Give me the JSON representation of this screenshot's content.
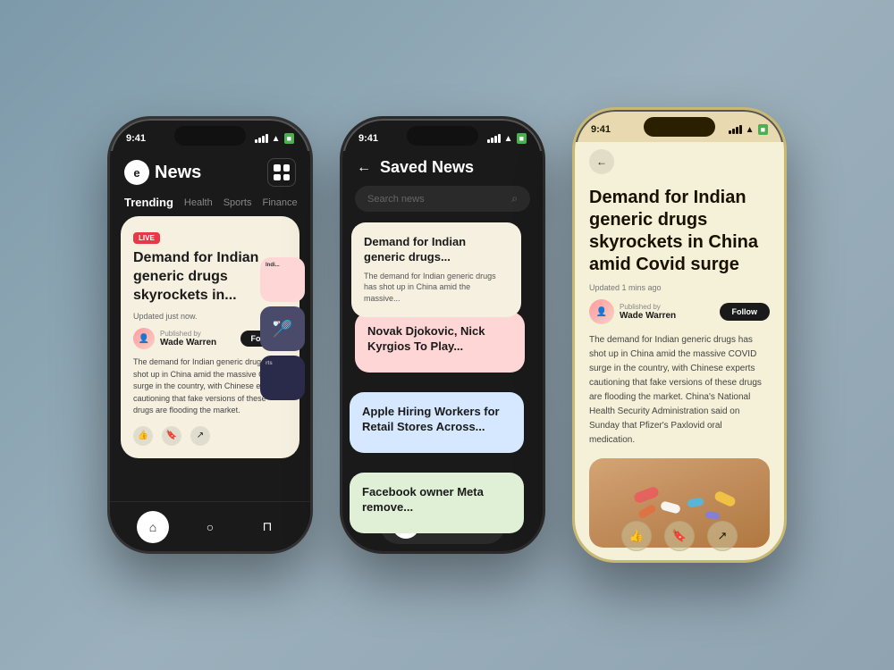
{
  "app": {
    "name": "News",
    "logo_letter": "e",
    "status_time": "9:41"
  },
  "phone1": {
    "header": {
      "logo_text": "News"
    },
    "nav": {
      "tabs": [
        {
          "label": "Trending",
          "active": true
        },
        {
          "label": "Health",
          "active": false
        },
        {
          "label": "Sports",
          "active": false
        },
        {
          "label": "Finance",
          "active": false
        }
      ]
    },
    "main_card": {
      "live_badge": "LIVE",
      "title": "Demand for Indian generic drugs skyrockets in...",
      "updated": "Updated just now.",
      "published_by": "Published by",
      "author": "Wade Warren",
      "follow_label": "Follow",
      "body": "The demand for Indian generic drugs has shot up in China amid the massive COVID surge in the country, with Chinese experts cautioning that fake versions of these drugs are flooding the market."
    },
    "bottom_nav": {
      "home_icon": "⌂",
      "search_icon": "○",
      "bookmark_icon": "⊓"
    }
  },
  "phone2": {
    "header": {
      "back_icon": "←",
      "title": "Saved News"
    },
    "search": {
      "placeholder": "Search news"
    },
    "cards": [
      {
        "title": "Demand for Indian generic drugs...",
        "desc": "The demand for Indian generic drugs has shot up in China amid the massive...",
        "color": "#f5f0e0"
      },
      {
        "title": "Novak Djokovic, Nick Kyrgios To Play...",
        "desc": "",
        "color": "#ffd6d6"
      },
      {
        "title": "Apple Hiring Workers for Retail Stores Across...",
        "desc": "",
        "color": "#d6e8ff"
      },
      {
        "title": "Facebook owner Meta remove...",
        "desc": "",
        "color": "#d8f0d0"
      }
    ],
    "bottom_nav": {
      "home_icon": "⌂",
      "search_icon": "○",
      "bookmark_icon": "⊓"
    }
  },
  "phone3": {
    "header": {
      "back_icon": "←"
    },
    "article": {
      "title": "Demand for Indian generic drugs skyrockets in China amid Covid surge",
      "updated": "Updated 1 mins ago",
      "published_by": "Published by",
      "author": "Wade Warren",
      "follow_label": "Follow",
      "body": "The demand for Indian generic drugs has shot up in China amid the massive COVID surge in the country, with Chinese experts cautioning that fake versions of these drugs are flooding the market. China's National Health Security Administration said on Sunday that Pfizer's Paxlovid oral medication."
    },
    "actions": {
      "like": "👍",
      "bookmark": "🔖",
      "share": "↗"
    }
  }
}
